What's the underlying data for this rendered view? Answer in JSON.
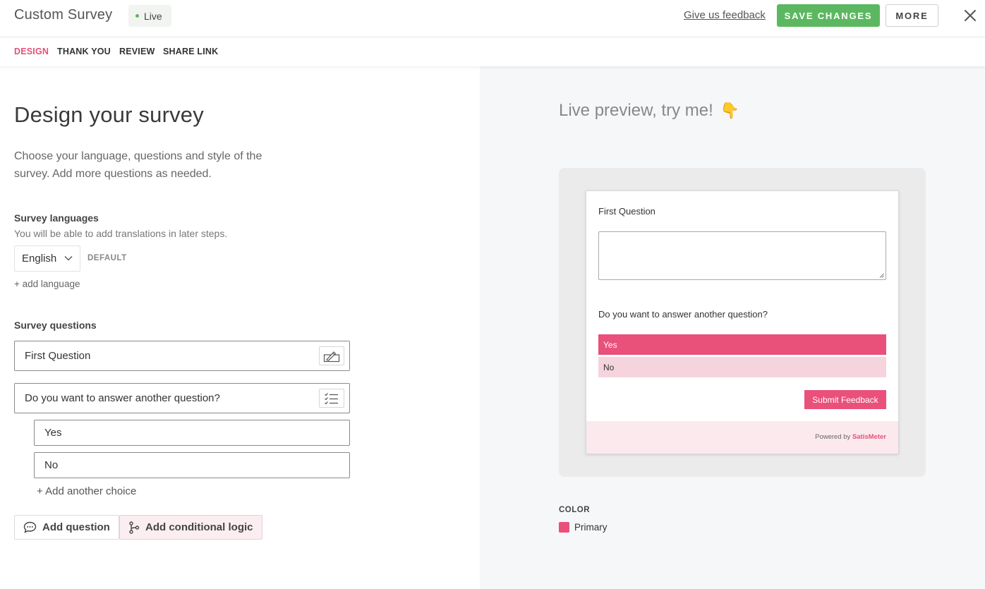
{
  "header": {
    "title": "Custom Survey",
    "status": "Live",
    "feedback_link": "Give us feedback",
    "save_label": "SAVE CHANGES",
    "more_label": "MORE"
  },
  "tabs": [
    {
      "label": "DESIGN",
      "active": true
    },
    {
      "label": "THANK YOU",
      "active": false
    },
    {
      "label": "REVIEW",
      "active": false
    },
    {
      "label": "SHARE LINK",
      "active": false
    }
  ],
  "design": {
    "heading": "Design your survey",
    "description": "Choose your language, questions and style of the survey. Add more questions as needed.",
    "languages": {
      "label": "Survey languages",
      "help": "You will be able to add translations in later steps.",
      "selected": "English",
      "default_tag": "DEFAULT",
      "add_link": "+ add language"
    },
    "questions": {
      "label": "Survey questions",
      "items": [
        {
          "text": "First Question",
          "type_icon": "text-input-icon"
        },
        {
          "text": "Do you want to answer another question?",
          "type_icon": "multiple-choice-icon"
        }
      ],
      "choices": [
        "Yes",
        "No"
      ],
      "add_choice": "+ Add another choice",
      "add_question": "Add question",
      "add_logic": "Add conditional logic"
    }
  },
  "preview": {
    "title": "Live preview, try me!",
    "emoji": "👇",
    "question1": "First Question",
    "question2": "Do you want to answer another question?",
    "options": [
      "Yes",
      "No"
    ],
    "submit": "Submit Feedback",
    "powered_by": "Powered by",
    "brand": "SatisMeter"
  },
  "color": {
    "label": "COLOR",
    "primary_label": "Primary",
    "primary_hex": "#e9507a"
  },
  "colors": {
    "accent": "#e8507a",
    "save_green": "#5cb860",
    "live_dot": "#5cb85c"
  }
}
